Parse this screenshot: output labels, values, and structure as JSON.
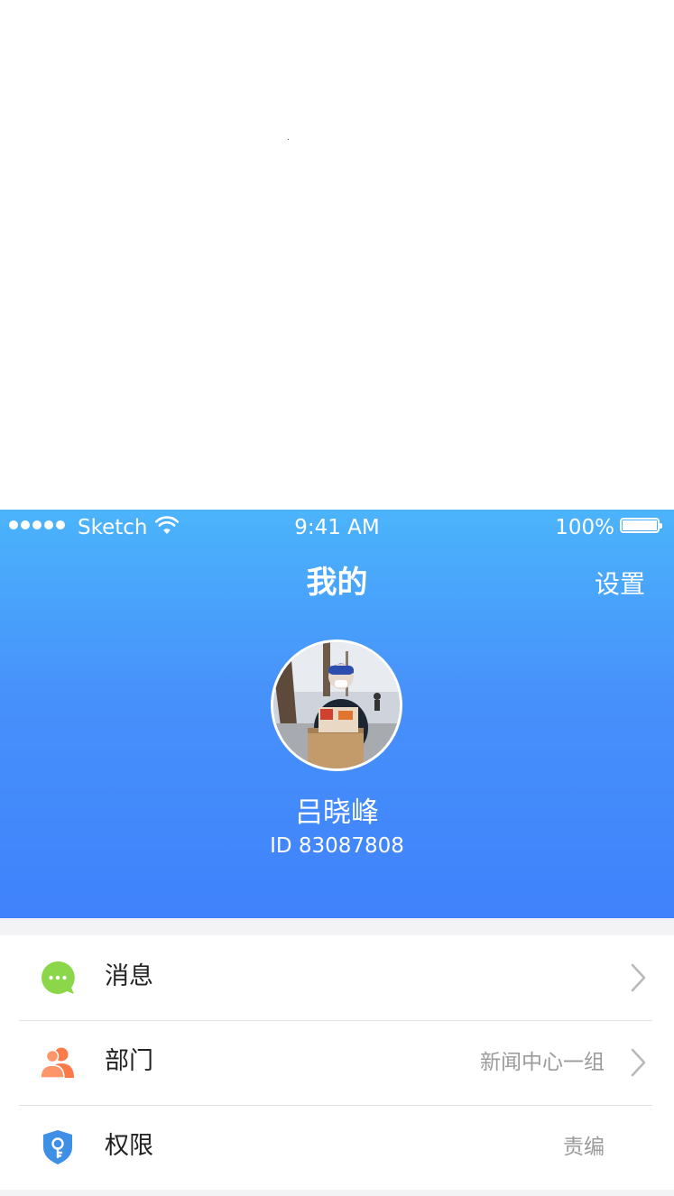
{
  "status_bar": {
    "carrier": "Sketch",
    "time": "9:41 AM",
    "battery": "100%"
  },
  "nav": {
    "title": "我的",
    "settings_label": "设置"
  },
  "profile": {
    "name": "吕晓峰",
    "id_text": "ID 83087808"
  },
  "menu": {
    "items": [
      {
        "label": "消息",
        "value": "",
        "icon": "chat-bubble-icon",
        "icon_color": "#8cd64a"
      },
      {
        "label": "部门",
        "value": "新闻中心一组",
        "icon": "people-icon",
        "icon_color": "#fa7a4a"
      },
      {
        "label": "权限",
        "value": "责编",
        "icon": "shield-key-icon",
        "icon_color": "#3f8fe6"
      }
    ]
  },
  "colors": {
    "header_top": "#4bb4fb",
    "header_bottom": "#3f82fb",
    "page_bg": "#f3f3f5"
  }
}
